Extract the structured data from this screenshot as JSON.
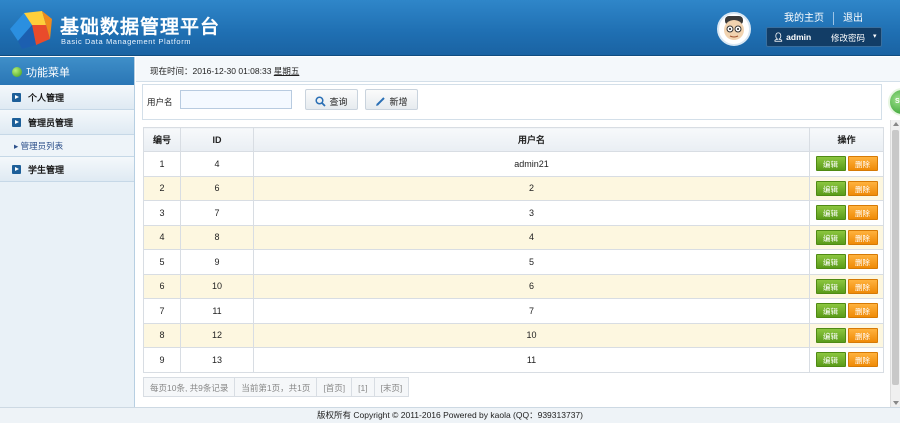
{
  "header": {
    "title": "基础数据管理平台",
    "subtitle": "Basic Data Management Platform",
    "home_link": "我的主页",
    "logout_link": "退出",
    "username": "admin",
    "change_password": "修改密码"
  },
  "sidebar": {
    "menu_title": "功能菜单",
    "items": [
      {
        "label": "个人管理"
      },
      {
        "label": "管理员管理"
      },
      {
        "label": "学生管理"
      }
    ],
    "submenu_label": "管理员列表"
  },
  "main": {
    "time_label": "现在时间：2016-12-30 01:08:33",
    "weekday": "星期五",
    "search": {
      "label": "用户名",
      "value": "",
      "placeholder": "",
      "query_button": "查询",
      "add_button": "新增"
    },
    "table": {
      "headers": [
        "编号",
        "ID",
        "用户名",
        "操作"
      ],
      "edit_label": "编辑",
      "delete_label": "删除",
      "rows": [
        {
          "no": "1",
          "id": "4",
          "username": "admin21"
        },
        {
          "no": "2",
          "id": "6",
          "username": "2"
        },
        {
          "no": "3",
          "id": "7",
          "username": "3"
        },
        {
          "no": "4",
          "id": "8",
          "username": "4"
        },
        {
          "no": "5",
          "id": "9",
          "username": "5"
        },
        {
          "no": "6",
          "id": "10",
          "username": "6"
        },
        {
          "no": "7",
          "id": "11",
          "username": "7"
        },
        {
          "no": "8",
          "id": "12",
          "username": "10"
        },
        {
          "no": "9",
          "id": "13",
          "username": "11"
        }
      ]
    },
    "pager": {
      "summary": "每页10条, 共9条记录",
      "current": "当前第1页，共1页",
      "first": "[首页]",
      "page": "[1]",
      "last": "[末页]"
    },
    "side_tab": "S1"
  },
  "footer": {
    "text": "版权所有 Copyright © 2011-2016 Powered by kaola (QQ：939313737)"
  },
  "colors": {
    "header_blue": "#1f6fb2",
    "edit_green": "#5a9b1a",
    "delete_orange": "#ef8a07",
    "row_alt": "#fdf7e0"
  }
}
